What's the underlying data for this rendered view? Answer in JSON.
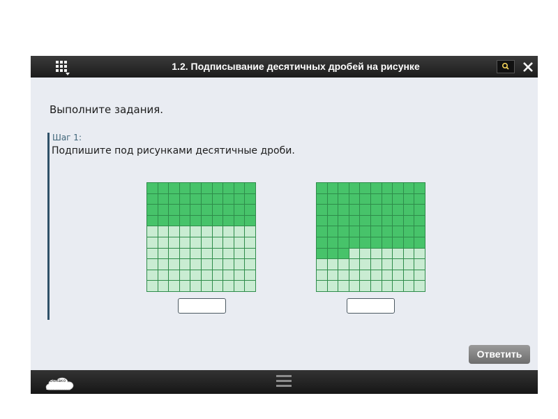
{
  "window": {
    "title": "1.2. Подписывание десятичных дробей на рисунке"
  },
  "icons": {
    "menu": "grid-menu-icon",
    "search": "search-icon",
    "close": "close-icon",
    "handle": "drag-handle-icon",
    "logo": "cloud-logo-icon"
  },
  "main": {
    "instruction": "Выполните задания.",
    "step_label": "Шаг 1:",
    "step_text": "Подпишите под рисунками десятичные дроби.",
    "figures": [
      {
        "filled_cells": 40,
        "total_cells": 100
      },
      {
        "filled_cells": 63,
        "total_cells": 100
      }
    ],
    "answer_inputs": [
      {
        "value": ""
      },
      {
        "value": ""
      }
    ]
  },
  "footer": {
    "answer_button": "Ответить",
    "logo_line1": "Облако",
    "logo_line2": "знаний"
  },
  "colors": {
    "filled": "#47c36a",
    "empty": "#c9ecd2",
    "grid_line": "#2e8c4a",
    "step_bar": "#2f5168",
    "content_bg": "#e9ecf2"
  }
}
